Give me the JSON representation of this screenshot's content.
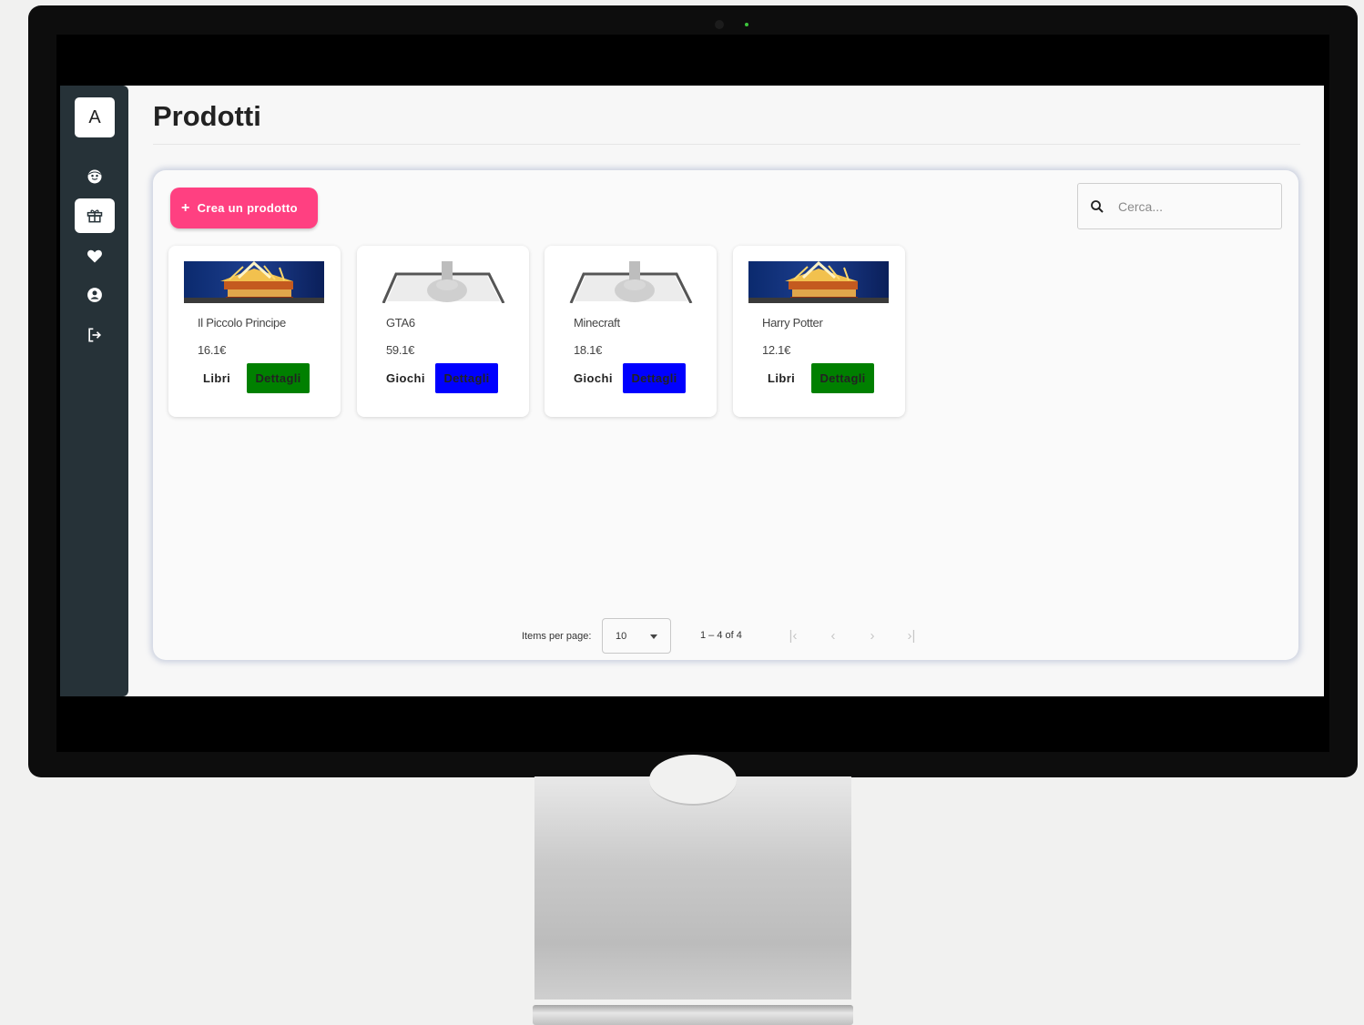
{
  "page": {
    "title": "Prodotti"
  },
  "sidebar": {
    "avatar_letter": "A",
    "items": [
      {
        "icon": "face-icon",
        "active": false
      },
      {
        "icon": "gift-icon",
        "active": true
      },
      {
        "icon": "heart-icon",
        "active": false
      },
      {
        "icon": "account-icon",
        "active": false
      },
      {
        "icon": "logout-icon",
        "active": false
      }
    ]
  },
  "toolbar": {
    "create_label": "Crea un prodotto",
    "create_color": "#ff4081"
  },
  "search": {
    "placeholder": "Cerca..."
  },
  "products": [
    {
      "name": "Il Piccolo Principe",
      "price": "16.1€",
      "category": "Libri",
      "details_label": "Dettagli",
      "details_color": "#008000",
      "image": "book-image"
    },
    {
      "name": "GTA6",
      "price": "59.1€",
      "category": "Giochi",
      "details_label": "Dettagli",
      "details_color": "#0000ff",
      "image": "game-image"
    },
    {
      "name": "Minecraft",
      "price": "18.1€",
      "category": "Giochi",
      "details_label": "Dettagli",
      "details_color": "#0000ff",
      "image": "game-image"
    },
    {
      "name": "Harry Potter",
      "price": "12.1€",
      "category": "Libri",
      "details_label": "Dettagli",
      "details_color": "#008000",
      "image": "book-image"
    }
  ],
  "paginator": {
    "items_per_page_label": "Items per page:",
    "page_size": "10",
    "range_label": "1 – 4 of 4"
  }
}
